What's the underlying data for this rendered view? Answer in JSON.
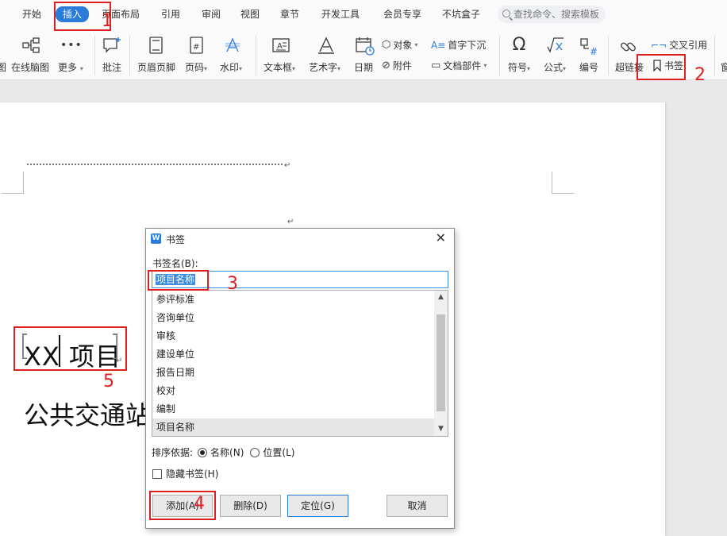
{
  "menu": {
    "tabs": [
      {
        "label": "开始"
      },
      {
        "label": "插入"
      },
      {
        "label": "页面布局"
      },
      {
        "label": "引用"
      },
      {
        "label": "审阅"
      },
      {
        "label": "视图"
      },
      {
        "label": "章节"
      },
      {
        "label": "开发工具"
      },
      {
        "label": "会员专享"
      },
      {
        "label": "不坑盒子"
      }
    ],
    "active_tab": "插入",
    "search_placeholder": "查找命令、搜索模板"
  },
  "ribbon": {
    "mindmap": "在线脑图",
    "more": "更多",
    "comment": "批注",
    "header_footer": "页眉页脚",
    "page_number": "页码",
    "watermark": "水印",
    "textbox": "文本框",
    "wordart": "艺术字",
    "date": "日期",
    "object": "对象",
    "attachment": "附件",
    "drop_cap": "首字下沉",
    "doc_parts": "文档部件",
    "symbol": "符号",
    "formula": "公式",
    "numbering": "编号",
    "hyperlink": "超链接",
    "cross_ref": "交叉引用",
    "bookmark": "书签"
  },
  "document": {
    "title": "XX 项目",
    "subtitle": "公共交通站"
  },
  "dialog": {
    "title": "书签",
    "name_label": "书签名(B):",
    "name_value": "项目名称",
    "items": [
      {
        "label": "参评标准"
      },
      {
        "label": "咨询单位"
      },
      {
        "label": "审核"
      },
      {
        "label": "建设单位"
      },
      {
        "label": "报告日期"
      },
      {
        "label": "校对"
      },
      {
        "label": "编制"
      },
      {
        "label": "项目名称"
      }
    ],
    "selected_item": "项目名称",
    "sort_label": "排序依据:",
    "sort_name": "名称(N)",
    "sort_position": "位置(L)",
    "sort_selected": "名称(N)",
    "hidden_label": "隐藏书签(H)",
    "hidden_checked": false,
    "add_button": "添加(A)",
    "delete_button": "删除(D)",
    "goto_button": "定位(G)",
    "cancel_button": "取消"
  },
  "annotations": {
    "n1": "1",
    "n2": "2",
    "n3": "3",
    "n4": "4",
    "n5": "5",
    "color": "#e02020"
  },
  "colors": {
    "accent": "#2b7cd9",
    "annotation": "#e02020"
  }
}
